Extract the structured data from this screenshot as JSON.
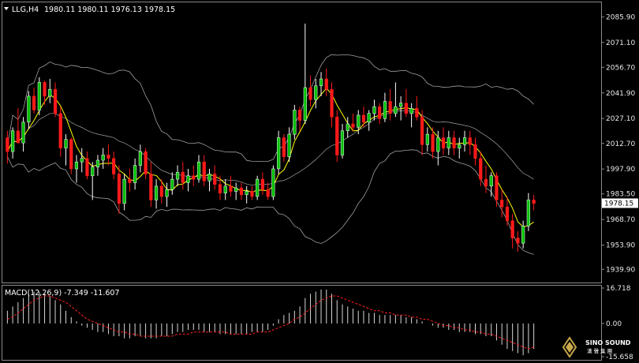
{
  "header": {
    "symbol": "LLG,H4",
    "ohlc": "1980.11 1980.11 1976.13 1978.15"
  },
  "price_axis": {
    "ticks": [
      "2085.90",
      "2071.10",
      "2056.70",
      "2041.90",
      "2027.10",
      "2012.70",
      "1997.90",
      "1983.50",
      "1968.70",
      "1953.90",
      "1939.90"
    ],
    "current": "1978.15"
  },
  "macd": {
    "label": "MACD(12,26,9) -7.349 -11.607",
    "ticks": [
      "16.718",
      "0.00",
      "-15.658"
    ]
  },
  "logo": {
    "name": "SINO SOUND",
    "cn": "漢 聲 集 團"
  },
  "colors": {
    "bull": "#ffffff",
    "bullBody": "#00c000",
    "bear": "#ff1a1a",
    "band": "#a0a0a0",
    "ma": "#ffff00",
    "signal": "#ff2020"
  },
  "chart_data": {
    "type": "candlestick",
    "ylim": [
      1935,
      2092
    ],
    "series": [
      {
        "o": 2016,
        "h": 2020,
        "l": 2001,
        "c": 2008
      },
      {
        "o": 2008,
        "h": 2022,
        "l": 2004,
        "c": 2020
      },
      {
        "o": 2020,
        "h": 2033,
        "l": 2016,
        "c": 2013
      },
      {
        "o": 2013,
        "h": 2028,
        "l": 2008,
        "c": 2025
      },
      {
        "o": 2025,
        "h": 2043,
        "l": 2021,
        "c": 2040
      },
      {
        "o": 2040,
        "h": 2045,
        "l": 2030,
        "c": 2032
      },
      {
        "o": 2032,
        "h": 2051,
        "l": 2029,
        "c": 2048
      },
      {
        "o": 2048,
        "h": 2049,
        "l": 2035,
        "c": 2040
      },
      {
        "o": 2040,
        "h": 2050,
        "l": 2036,
        "c": 2044
      },
      {
        "o": 2044,
        "h": 2048,
        "l": 2028,
        "c": 2030
      },
      {
        "o": 2030,
        "h": 2034,
        "l": 2005,
        "c": 2010
      },
      {
        "o": 2010,
        "h": 2018,
        "l": 2000,
        "c": 2015
      },
      {
        "o": 2015,
        "h": 2016,
        "l": 1995,
        "c": 1998
      },
      {
        "o": 1998,
        "h": 2006,
        "l": 1990,
        "c": 2002
      },
      {
        "o": 2002,
        "h": 2010,
        "l": 1996,
        "c": 2004
      },
      {
        "o": 2004,
        "h": 2008,
        "l": 1992,
        "c": 1994
      },
      {
        "o": 1994,
        "h": 2002,
        "l": 1980,
        "c": 1999
      },
      {
        "o": 1999,
        "h": 2006,
        "l": 1994,
        "c": 2003
      },
      {
        "o": 2003,
        "h": 2010,
        "l": 1998,
        "c": 2006
      },
      {
        "o": 2006,
        "h": 2012,
        "l": 2000,
        "c": 2004
      },
      {
        "o": 2004,
        "h": 2008,
        "l": 1992,
        "c": 1995
      },
      {
        "o": 1995,
        "h": 2000,
        "l": 1972,
        "c": 1978
      },
      {
        "o": 1978,
        "h": 1995,
        "l": 1974,
        "c": 1992
      },
      {
        "o": 1992,
        "h": 1998,
        "l": 1985,
        "c": 1990
      },
      {
        "o": 1990,
        "h": 2004,
        "l": 1986,
        "c": 2000
      },
      {
        "o": 2000,
        "h": 2012,
        "l": 1996,
        "c": 2008
      },
      {
        "o": 2008,
        "h": 2010,
        "l": 1992,
        "c": 1995
      },
      {
        "o": 1995,
        "h": 2002,
        "l": 1976,
        "c": 1980
      },
      {
        "o": 1980,
        "h": 1992,
        "l": 1975,
        "c": 1988
      },
      {
        "o": 1988,
        "h": 1992,
        "l": 1978,
        "c": 1982
      },
      {
        "o": 1982,
        "h": 1990,
        "l": 1976,
        "c": 1986
      },
      {
        "o": 1986,
        "h": 1996,
        "l": 1983,
        "c": 1992
      },
      {
        "o": 1992,
        "h": 2000,
        "l": 1988,
        "c": 1996
      },
      {
        "o": 1996,
        "h": 2002,
        "l": 1986,
        "c": 1990
      },
      {
        "o": 1990,
        "h": 1998,
        "l": 1985,
        "c": 1994
      },
      {
        "o": 1994,
        "h": 2000,
        "l": 1988,
        "c": 1992
      },
      {
        "o": 1992,
        "h": 2006,
        "l": 1990,
        "c": 2002
      },
      {
        "o": 2002,
        "h": 2006,
        "l": 1988,
        "c": 1991
      },
      {
        "o": 1991,
        "h": 1998,
        "l": 1985,
        "c": 1995
      },
      {
        "o": 1995,
        "h": 2000,
        "l": 1986,
        "c": 1989
      },
      {
        "o": 1989,
        "h": 1994,
        "l": 1980,
        "c": 1984
      },
      {
        "o": 1984,
        "h": 1992,
        "l": 1980,
        "c": 1988
      },
      {
        "o": 1988,
        "h": 1994,
        "l": 1982,
        "c": 1985
      },
      {
        "o": 1985,
        "h": 1990,
        "l": 1980,
        "c": 1987
      },
      {
        "o": 1987,
        "h": 1990,
        "l": 1980,
        "c": 1983
      },
      {
        "o": 1983,
        "h": 1988,
        "l": 1978,
        "c": 1985
      },
      {
        "o": 1985,
        "h": 1988,
        "l": 1980,
        "c": 1982
      },
      {
        "o": 1982,
        "h": 1994,
        "l": 1980,
        "c": 1992
      },
      {
        "o": 1992,
        "h": 1996,
        "l": 1983,
        "c": 1986
      },
      {
        "o": 1986,
        "h": 1990,
        "l": 1980,
        "c": 1982
      },
      {
        "o": 1982,
        "h": 2000,
        "l": 1980,
        "c": 1998
      },
      {
        "o": 1998,
        "h": 2020,
        "l": 1995,
        "c": 2016
      },
      {
        "o": 2016,
        "h": 2018,
        "l": 2002,
        "c": 2005
      },
      {
        "o": 2005,
        "h": 2022,
        "l": 2002,
        "c": 2018
      },
      {
        "o": 2018,
        "h": 2035,
        "l": 2015,
        "c": 2032
      },
      {
        "o": 2032,
        "h": 2034,
        "l": 2020,
        "c": 2026
      },
      {
        "o": 2026,
        "h": 2082,
        "l": 2024,
        "c": 2045
      },
      {
        "o": 2045,
        "h": 2052,
        "l": 2034,
        "c": 2038
      },
      {
        "o": 2038,
        "h": 2050,
        "l": 2033,
        "c": 2046
      },
      {
        "o": 2046,
        "h": 2054,
        "l": 2040,
        "c": 2050
      },
      {
        "o": 2050,
        "h": 2056,
        "l": 2040,
        "c": 2044
      },
      {
        "o": 2044,
        "h": 2048,
        "l": 2022,
        "c": 2028
      },
      {
        "o": 2028,
        "h": 2032,
        "l": 2002,
        "c": 2006
      },
      {
        "o": 2006,
        "h": 2024,
        "l": 2004,
        "c": 2020
      },
      {
        "o": 2020,
        "h": 2028,
        "l": 2016,
        "c": 2024
      },
      {
        "o": 2024,
        "h": 2030,
        "l": 2020,
        "c": 2022
      },
      {
        "o": 2022,
        "h": 2032,
        "l": 2018,
        "c": 2029
      },
      {
        "o": 2029,
        "h": 2034,
        "l": 2022,
        "c": 2025
      },
      {
        "o": 2025,
        "h": 2032,
        "l": 2020,
        "c": 2030
      },
      {
        "o": 2030,
        "h": 2038,
        "l": 2026,
        "c": 2034
      },
      {
        "o": 2034,
        "h": 2036,
        "l": 2024,
        "c": 2027
      },
      {
        "o": 2027,
        "h": 2042,
        "l": 2025,
        "c": 2037
      },
      {
        "o": 2037,
        "h": 2044,
        "l": 2026,
        "c": 2030
      },
      {
        "o": 2030,
        "h": 2048,
        "l": 2028,
        "c": 2034
      },
      {
        "o": 2034,
        "h": 2040,
        "l": 2026,
        "c": 2036
      },
      {
        "o": 2036,
        "h": 2044,
        "l": 2028,
        "c": 2030
      },
      {
        "o": 2030,
        "h": 2036,
        "l": 2022,
        "c": 2033
      },
      {
        "o": 2033,
        "h": 2040,
        "l": 2026,
        "c": 2028
      },
      {
        "o": 2028,
        "h": 2032,
        "l": 2006,
        "c": 2012
      },
      {
        "o": 2012,
        "h": 2022,
        "l": 2008,
        "c": 2018
      },
      {
        "o": 2018,
        "h": 2022,
        "l": 2004,
        "c": 2008
      },
      {
        "o": 2008,
        "h": 2020,
        "l": 2000,
        "c": 2016
      },
      {
        "o": 2016,
        "h": 2022,
        "l": 2006,
        "c": 2010
      },
      {
        "o": 2010,
        "h": 2020,
        "l": 2006,
        "c": 2016
      },
      {
        "o": 2016,
        "h": 2020,
        "l": 2006,
        "c": 2010
      },
      {
        "o": 2010,
        "h": 2016,
        "l": 2004,
        "c": 2012
      },
      {
        "o": 2012,
        "h": 2020,
        "l": 2008,
        "c": 2016
      },
      {
        "o": 2016,
        "h": 2020,
        "l": 2006,
        "c": 2012
      },
      {
        "o": 2012,
        "h": 2016,
        "l": 2000,
        "c": 2004
      },
      {
        "o": 2004,
        "h": 2008,
        "l": 1988,
        "c": 1992
      },
      {
        "o": 1992,
        "h": 2000,
        "l": 1984,
        "c": 1988
      },
      {
        "o": 1988,
        "h": 1996,
        "l": 1982,
        "c": 1994
      },
      {
        "o": 1994,
        "h": 1996,
        "l": 1976,
        "c": 1980
      },
      {
        "o": 1980,
        "h": 1986,
        "l": 1970,
        "c": 1976
      },
      {
        "o": 1976,
        "h": 1982,
        "l": 1965,
        "c": 1968
      },
      {
        "o": 1968,
        "h": 1972,
        "l": 1952,
        "c": 1958
      },
      {
        "o": 1958,
        "h": 1962,
        "l": 1950,
        "c": 1955
      },
      {
        "o": 1955,
        "h": 1968,
        "l": 1952,
        "c": 1965
      },
      {
        "o": 1965,
        "h": 1984,
        "l": 1962,
        "c": 1980
      },
      {
        "o": 1980,
        "h": 1983,
        "l": 1974,
        "c": 1978
      }
    ],
    "macd_hist": [
      6,
      8,
      10,
      12,
      14,
      15,
      15,
      14,
      13,
      11,
      9,
      6,
      3,
      1,
      -1,
      -2,
      -3,
      -4,
      -4,
      -5,
      -6,
      -6,
      -7,
      -7,
      -6,
      -6,
      -7,
      -7,
      -7,
      -6,
      -6,
      -5,
      -4,
      -4,
      -3,
      -3,
      -3,
      -4,
      -4,
      -4,
      -5,
      -5,
      -5,
      -5,
      -5,
      -5,
      -4,
      -4,
      -4,
      -3,
      -1,
      2,
      4,
      5,
      6,
      8,
      12,
      14,
      15,
      16,
      16,
      14,
      11,
      9,
      8,
      7,
      6,
      6,
      5,
      5,
      4,
      4,
      4,
      4,
      4,
      3,
      3,
      2,
      1,
      0,
      -1,
      -2,
      -2,
      -3,
      -3,
      -4,
      -4,
      -4,
      -5,
      -5,
      -6,
      -6,
      -8,
      -10,
      -12,
      -13,
      -14,
      -15,
      -14,
      -12
    ],
    "macd_signal": [
      2,
      3,
      5,
      7,
      9,
      11,
      12,
      13,
      13,
      12,
      11,
      10,
      8,
      6,
      4,
      2,
      1,
      0,
      -1,
      -2,
      -3,
      -4,
      -4,
      -5,
      -5,
      -6,
      -6,
      -6,
      -6,
      -6,
      -6,
      -6,
      -5,
      -5,
      -5,
      -4,
      -4,
      -4,
      -4,
      -4,
      -4,
      -4,
      -5,
      -5,
      -5,
      -5,
      -5,
      -4,
      -4,
      -4,
      -3,
      -2,
      -1,
      0,
      2,
      3,
      5,
      7,
      9,
      11,
      12,
      13,
      13,
      12,
      11,
      10,
      9,
      8,
      7,
      6,
      6,
      5,
      5,
      4,
      4,
      4,
      3,
      3,
      2,
      2,
      1,
      0,
      -1,
      -1,
      -2,
      -2,
      -3,
      -3,
      -4,
      -4,
      -5,
      -5,
      -6,
      -7,
      -8,
      -9,
      -10,
      -11,
      -12,
      -11
    ]
  }
}
